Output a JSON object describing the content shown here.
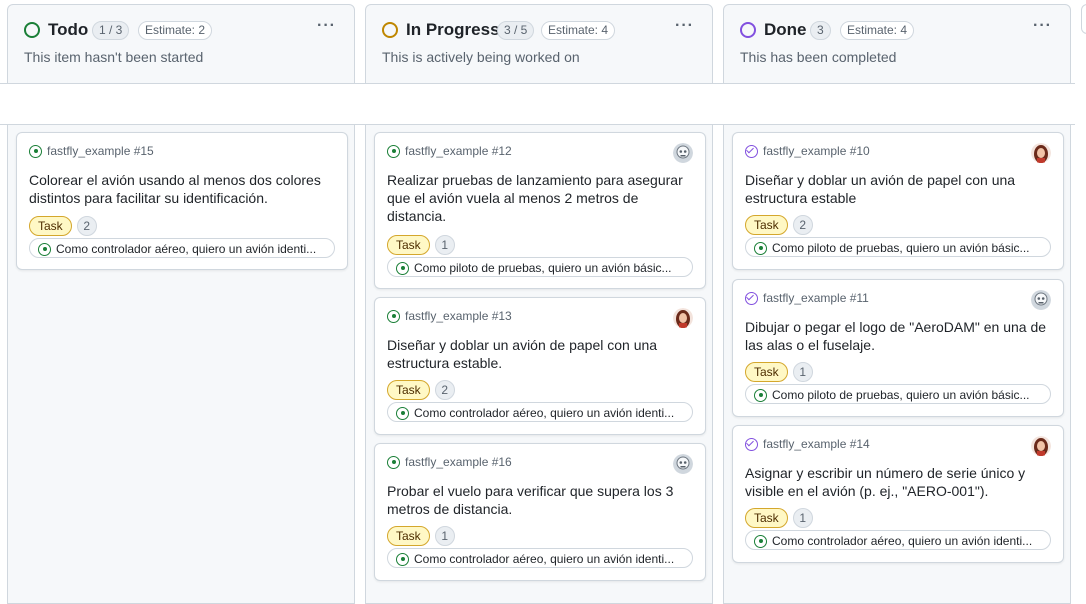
{
  "columns": [
    {
      "title": "Todo",
      "count": "1 / 3",
      "estimate": "Estimate: 2",
      "description": "This item hasn't been started",
      "status_color": "#1a7f37"
    },
    {
      "title": "In Progress",
      "count": "3 / 5",
      "estimate": "Estimate: 4",
      "description": "This is actively being worked on",
      "status_color": "#bf8700"
    },
    {
      "title": "Done",
      "count": "3",
      "estimate": "Estimate: 4",
      "description": "This has been completed",
      "status_color": "#8250df"
    }
  ],
  "more_label": "···",
  "cards": [
    {
      "ref": "fastfly_example #15",
      "title": "Colorear el avión usando al menos dos colores distintos para facilitar su identificación.",
      "label": "Task",
      "points": "2",
      "parent": "Como controlador aéreo, quiero un avión identi...",
      "state": "open",
      "avatar": "none"
    },
    {
      "ref": "fastfly_example #12",
      "title": "Realizar pruebas de lanzamiento para asegurar que el avión vuela al menos 2 metros de distancia.",
      "label": "Task",
      "points": "1",
      "parent": "Como piloto de pruebas, quiero un avión básic...",
      "state": "open",
      "avatar": "robot"
    },
    {
      "ref": "fastfly_example #13",
      "title": "Diseñar y doblar un avión de papel con una estructura estable.",
      "label": "Task",
      "points": "2",
      "parent": "Como controlador aéreo, quiero un avión identi...",
      "state": "open",
      "avatar": "woman"
    },
    {
      "ref": "fastfly_example #16",
      "title": "Probar el vuelo para verificar que supera los 3 metros de distancia.",
      "label": "Task",
      "points": "1",
      "parent": "Como controlador aéreo, quiero un avión identi...",
      "state": "open",
      "avatar": "robot"
    },
    {
      "ref": "fastfly_example #10",
      "title": "Diseñar y doblar un avión de papel con una estructura estable",
      "label": "Task",
      "points": "2",
      "parent": "Como piloto de pruebas, quiero un avión básic...",
      "state": "done",
      "avatar": "woman"
    },
    {
      "ref": "fastfly_example #11",
      "title": "Dibujar o pegar el logo de \"AeroDAM\" en una de las alas o el fuselaje.",
      "label": "Task",
      "points": "1",
      "parent": "Como piloto de pruebas, quiero un avión básic...",
      "state": "done",
      "avatar": "robot"
    },
    {
      "ref": "fastfly_example #14",
      "title": "Asignar y escribir un número de serie único y visible en el avión (p. ej., \"AERO-001\").",
      "label": "Task",
      "points": "1",
      "parent": "Como controlador aéreo, quiero un avión identi...",
      "state": "done",
      "avatar": "woman"
    }
  ]
}
